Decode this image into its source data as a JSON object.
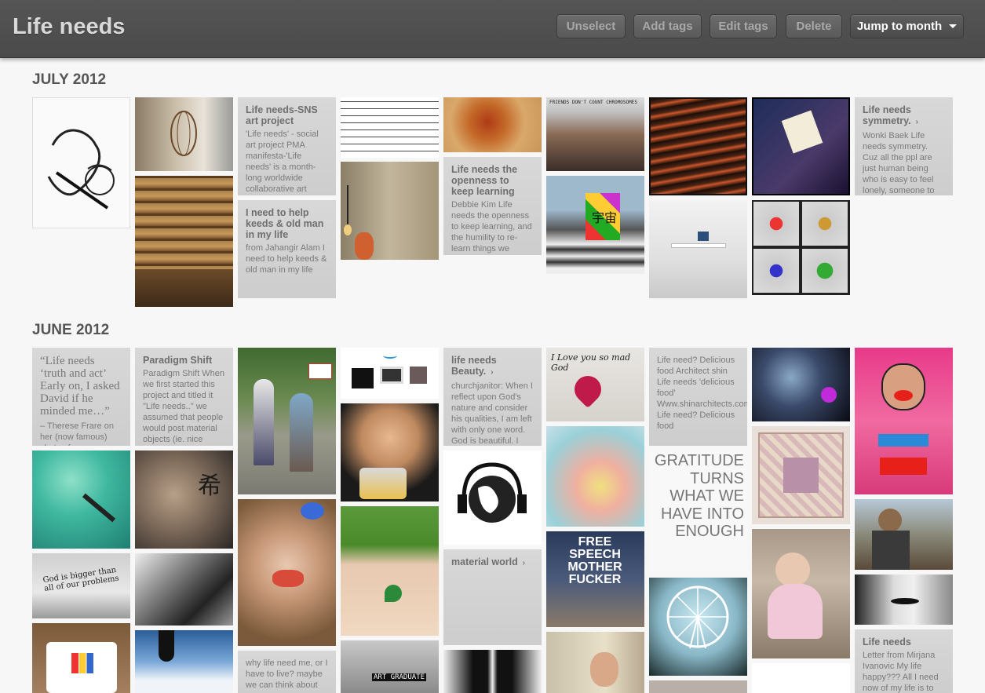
{
  "app": {
    "title": "Life needs"
  },
  "toolbar": {
    "unselect": "Unselect",
    "add_tags": "Add tags",
    "edit_tags": "Edit tags",
    "delete": "Delete",
    "jump_to_month": "Jump to month"
  },
  "sections": [
    {
      "heading": "JULY 2012",
      "cards": [
        {
          "title": "Life needs-SNS art project",
          "text": "'Life needs' - social art project PMA manifesta-'Life needs' is a month-long worldwide collaborative art"
        },
        {
          "title": "I need to help keeds & old man in my life",
          "text": "from Jahangir Alam I need to help keeds & old man in my life"
        },
        {
          "title": "Life needs the openness to keep learning",
          "text": "Debbie Kim Life needs the openness to keep learning, and the humility to re-learn things we"
        },
        {
          "title": "Life needs symmetry.",
          "text": "Wonki Baek Life needs symmetry. Cuz all the ppl are just human being who is easy to feel lonely, someone to"
        }
      ]
    },
    {
      "heading": "JUNE 2012",
      "cards": [
        {
          "quote": "“Life needs ‘truth and act’ Early on, I asked David if he minded me…”",
          "text": "– Therese Frare on her (now famous) shots of a young"
        },
        {
          "title": "Paradigm Shift",
          "text": "Paradigm Shift When we first started this project and titled it \"Life needs..\" we assumed that people would post material objects (ie. nice"
        },
        {
          "title": "life needs Beauty.",
          "text": "churchjanitor: When I reflect upon God's nature and consider his qualities, I am left with only one word. God is beautiful. I use"
        },
        {
          "title": "",
          "text": "Life need? Delicious food Architect shin Life needs 'delicious food' Www.shinarchitects.com Life need? Delicious food"
        },
        {
          "title": "material world",
          "text": ""
        },
        {
          "title": "",
          "text": "why life need me, or I have to live? maybe we can think about"
        },
        {
          "title": "Life needs",
          "text": "Letter from Mirjana Ivanovic My life happy??? All I need now of my life is to"
        }
      ],
      "gratitude": "GRATITUDE TURNS WHAT WE HAVE INTO ENOUGH",
      "photo_texts": {
        "love": "I Love you so mad God",
        "god": "God is bigger than all of our problems",
        "free": "FREE SPEECH MOTHER FUCKER",
        "graduate": "ART GRADUATE"
      }
    }
  ],
  "photo_captions": {
    "friends": "FRIENDS DON'T COUNT CHROMOSOMES",
    "banner": "宇宙"
  }
}
